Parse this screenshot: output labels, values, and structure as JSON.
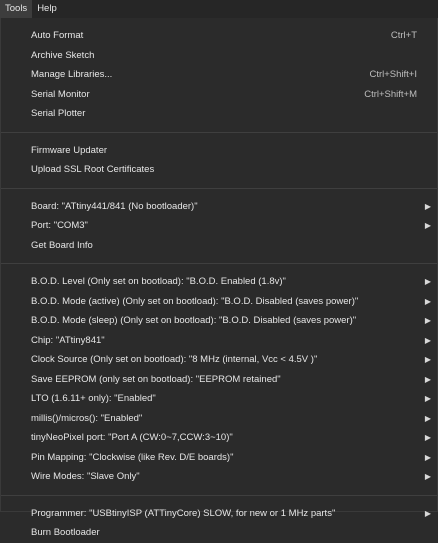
{
  "menubar": {
    "tools": "Tools",
    "help": "Help"
  },
  "group1": [
    {
      "label": "Auto Format",
      "shortcut": "Ctrl+T"
    },
    {
      "label": "Archive Sketch",
      "shortcut": ""
    },
    {
      "label": "Manage Libraries...",
      "shortcut": "Ctrl+Shift+I"
    },
    {
      "label": "Serial Monitor",
      "shortcut": "Ctrl+Shift+M"
    },
    {
      "label": "Serial Plotter",
      "shortcut": ""
    }
  ],
  "group2": [
    {
      "label": "Firmware Updater"
    },
    {
      "label": "Upload SSL Root Certificates"
    }
  ],
  "group3": [
    {
      "label": "Board: \"ATtiny441/841 (No bootloader)\""
    },
    {
      "label": "Port: \"COM3\""
    },
    {
      "label": "Get Board Info"
    }
  ],
  "group4": [
    {
      "label": "B.O.D. Level (Only set on bootload): \"B.O.D. Enabled (1.8v)\""
    },
    {
      "label": "B.O.D. Mode (active) (Only set on bootload): \"B.O.D. Disabled (saves power)\""
    },
    {
      "label": "B.O.D. Mode (sleep) (Only set on bootload): \"B.O.D. Disabled (saves power)\""
    },
    {
      "label": "Chip: \"ATtiny841\""
    },
    {
      "label": "Clock Source (Only set on bootload): \"8 MHz (internal, Vcc < 4.5V )\""
    },
    {
      "label": "Save EEPROM (only set on bootload): \"EEPROM retained\""
    },
    {
      "label": "LTO (1.6.11+ only): \"Enabled\""
    },
    {
      "label": "millis()/micros(): \"Enabled\""
    },
    {
      "label": "tinyNeoPixel port: \"Port A (CW:0~7,CCW:3~10)\""
    },
    {
      "label": "Pin Mapping: \"Clockwise (like Rev. D/E boards)\""
    },
    {
      "label": "Wire Modes: \"Slave Only\""
    }
  ],
  "group5": [
    {
      "label": "Programmer: \"USBtinyISP (ATTinyCore) SLOW, for new or 1 MHz parts\""
    },
    {
      "label": "Burn Bootloader"
    }
  ],
  "icons": {
    "submenu": "chevron-right-icon"
  },
  "colors": {
    "bg": "#2b2b2b",
    "text": "#e6e6e6",
    "separator": "#3f3f3f",
    "active_menu": "#3d3d3d"
  }
}
